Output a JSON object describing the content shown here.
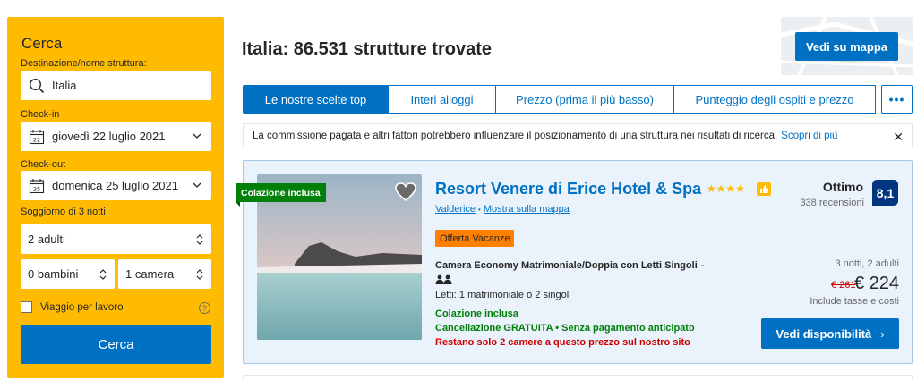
{
  "search": {
    "title": "Cerca",
    "destination_label": "Destinazione/nome struttura:",
    "destination_value": "Italia",
    "checkin_label": "Check-in",
    "checkin_value": "giovedì 22 luglio 2021",
    "checkout_label": "Check-out",
    "checkout_value": "domenica 25 luglio 2021",
    "stay_label": "Soggiorno di 3 notti",
    "adults": "2 adulti",
    "children": "0 bambini",
    "rooms": "1 camera",
    "business_label": "Viaggio per lavoro",
    "search_button": "Cerca"
  },
  "results": {
    "title": "Italia: 86.531 strutture trovate",
    "map_button": "Vedi su mappa"
  },
  "tabs": [
    {
      "label": "Le nostre scelte top",
      "active": true
    },
    {
      "label": "Interi alloggi",
      "active": false
    },
    {
      "label": "Prezzo (prima il più basso)",
      "active": false
    },
    {
      "label": "Punteggio degli ospiti e prezzo",
      "active": false
    }
  ],
  "notice": {
    "text": "La commissione pagata e altri fattori potrebbero influenzare il posizionamento di una struttura nei risultati di ricerca.",
    "link": "Scopri di più"
  },
  "property": {
    "badge": "Colazione inclusa",
    "name": "Resort Venere di Erice Hotel & Spa",
    "stars": "★★★★",
    "location": "Valderice",
    "map_link": "Mostra sulla mappa",
    "offer": "Offerta Vacanze",
    "room": "Camera Economy Matrimoniale/Doppia con Letti Singoli",
    "room_dash": "-",
    "beds": "Letti: 1 matrimoniale o 2 singoli",
    "breakfast": "Colazione inclusa",
    "cancellation": "Cancellazione GRATUITA • Senza pagamento anticipato",
    "scarcity": "Restano solo 2 camere a questo prezzo sul nostro sito",
    "rating_word": "Ottimo",
    "reviews": "338 recensioni",
    "score": "8,1",
    "nights": "3 notti, 2 adulti",
    "price_old": "€ 261",
    "price_new": "€ 224",
    "taxes": "Include tasse e costi",
    "availability_button": "Vedi disponibilità",
    "availability_arrow": "›"
  },
  "colors": {
    "brand_blue": "#0071c2",
    "sidebar_yellow": "#febb02",
    "score_navy": "#003580",
    "green": "#008009",
    "red": "#cc0000",
    "offer_orange": "#ff8000"
  }
}
